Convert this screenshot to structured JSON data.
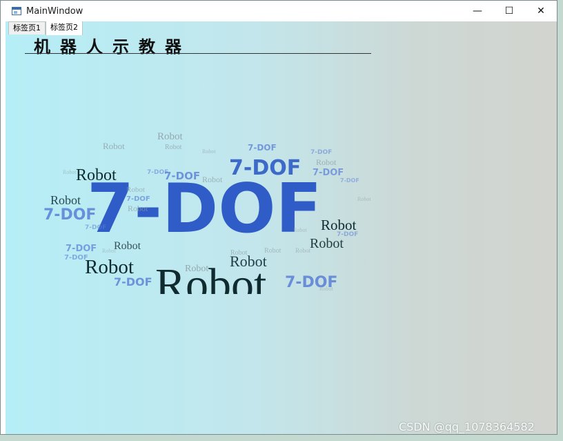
{
  "window": {
    "title": "MainWindow",
    "controls": {
      "minimize": "—",
      "maximize": "☐",
      "close": "✕"
    }
  },
  "tabs": [
    {
      "label": "标签页1",
      "active": false
    },
    {
      "label": "标签页2",
      "active": true
    }
  ],
  "page": {
    "heading": "机器人示教器"
  },
  "wordcloud": {
    "words": [
      "7-DOF",
      "Robot",
      "7-DOF",
      "Robot",
      "Robot",
      "Robot",
      "7-DOF",
      "7-DOF",
      "Robot",
      "Robot",
      "7-DOF",
      "Robot",
      "Robot",
      "7-DOF",
      "7-DOF",
      "7-DOF",
      "Robot",
      "7-DOF",
      "Robot",
      "7-DOF",
      "Robot",
      "7-DOF",
      "Robot",
      "Robot",
      "Robot",
      "Robot",
      "Robot",
      "7-DOF",
      "Robot",
      "7-DOF",
      "7-DOF",
      "7-DOF",
      "Robot",
      "7-DOF",
      "Robot",
      "Robot",
      "Robot",
      "7-DOF",
      "Robot",
      "Robot",
      "7-DOF",
      "Robot",
      "Robot",
      "7-DOF",
      "Robot"
    ],
    "colors": {
      "dof": "#2f5cc6",
      "dof_light": "#5a7fd6",
      "robot_dark": "#0f2b30",
      "robot_light": "#8a9aa0"
    }
  },
  "watermark": "CSDN @qq_1078364582"
}
